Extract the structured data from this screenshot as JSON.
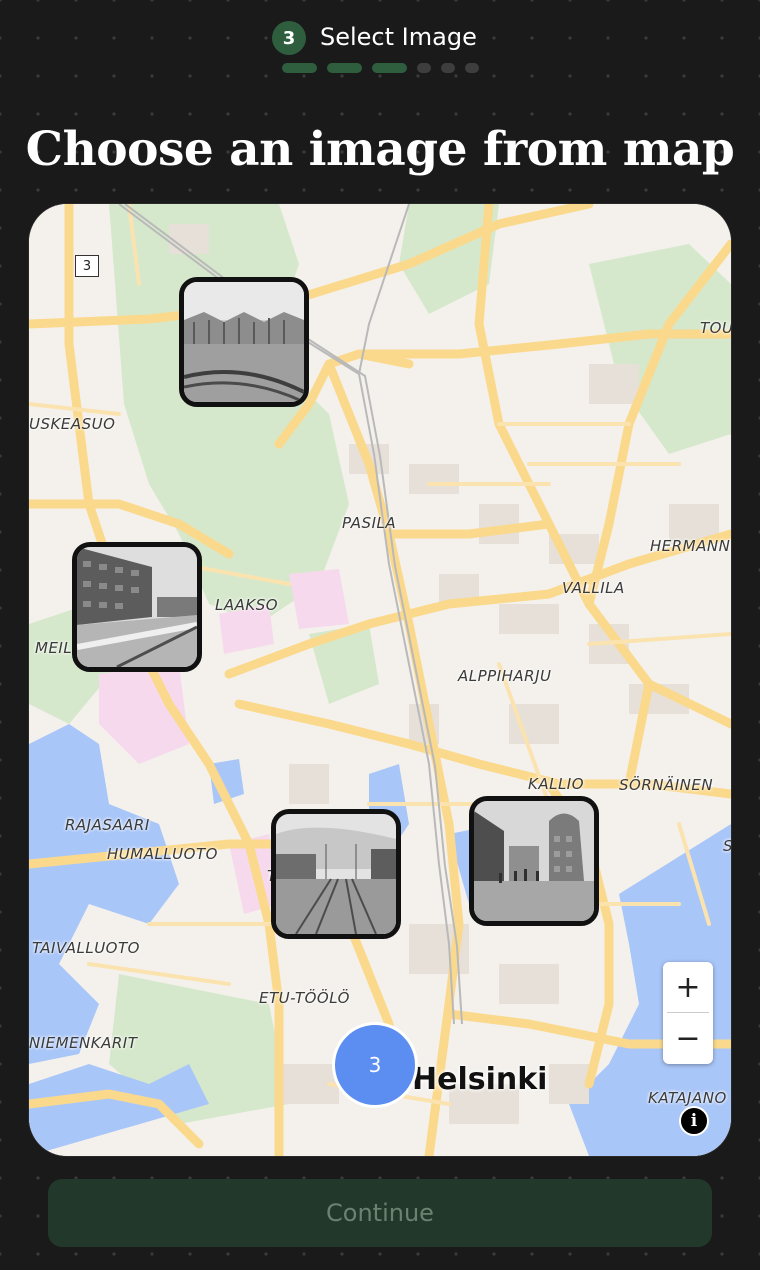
{
  "step": {
    "number": "3",
    "label": "Select Image",
    "total_segments": 6,
    "completed_segments": 3
  },
  "title": "Choose an image from map",
  "map": {
    "road_shield": "3",
    "places": {
      "uskeasuo": "USKEASUO",
      "pasila": "PASILA",
      "hermanni": "HERMANN",
      "vallila": "VALLILA",
      "laakso": "LAAKSO",
      "meil": "MEIL",
      "alppiharju": "ALPPIHARJU",
      "kallio": "KALLIO",
      "sornainen": "SÖRNÄINEN",
      "rajasaari": "RAJASAARI",
      "humalluoto": "HUMALLUOTO",
      "taivalluoto": "TAIVALLUOTO",
      "etu_toolo": "ETU-TÖÖLÖ",
      "niemenkarit": "NIEMENKARIT",
      "katajanokka": "KATAJANO",
      "tou": "TOU",
      "t_fragment": "T",
      "s_fragment": "S"
    },
    "city_label": "Helsinki",
    "cluster_count": "3",
    "zoom_in": "+",
    "zoom_out": "−",
    "info": "i",
    "colors": {
      "land": "#f4f1ec",
      "park": "#d6e8cc",
      "water": "#a9c6f8",
      "road": "#fbd98c",
      "pink": "#f6d9ec"
    }
  },
  "thumbnails": [
    {
      "name": "thumbnail-modern-building"
    },
    {
      "name": "thumbnail-street-apartments"
    },
    {
      "name": "thumbnail-tram-avenue"
    },
    {
      "name": "thumbnail-pedestrian-street"
    }
  ],
  "continue_label": "Continue"
}
